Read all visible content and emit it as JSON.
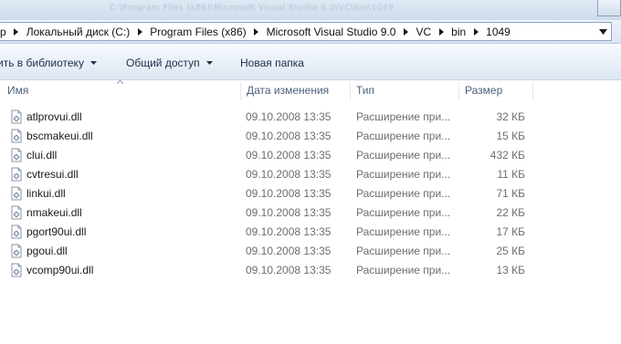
{
  "window": {
    "title": "C:\\Program Files (x86)\\Microsoft Visual Studio 9.0\\VC\\bin\\1049"
  },
  "address": {
    "breadcrumb": [
      {
        "label": "р"
      },
      {
        "label": "Локальный диск (C:)"
      },
      {
        "label": "Program Files (x86)"
      },
      {
        "label": "Microsoft Visual Studio 9.0"
      },
      {
        "label": "VC"
      },
      {
        "label": "bin"
      },
      {
        "label": "1049"
      }
    ]
  },
  "toolbar": {
    "library_label": "ить в библиотеку",
    "share_label": "Общий доступ",
    "new_folder_label": "Новая папка"
  },
  "columns": {
    "name": "Имя",
    "date": "Дата изменения",
    "type": "Тип",
    "size": "Размер"
  },
  "files": [
    {
      "name": "atlprovui.dll",
      "date": "09.10.2008 13:35",
      "type": "Расширение при...",
      "size": "32 КБ",
      "icon": "dll-file-icon"
    },
    {
      "name": "bscmakeui.dll",
      "date": "09.10.2008 13:35",
      "type": "Расширение при...",
      "size": "15 КБ",
      "icon": "dll-file-icon"
    },
    {
      "name": "clui.dll",
      "date": "09.10.2008 13:35",
      "type": "Расширение при...",
      "size": "432 КБ",
      "icon": "dll-file-icon"
    },
    {
      "name": "cvtresui.dll",
      "date": "09.10.2008 13:35",
      "type": "Расширение при...",
      "size": "11 КБ",
      "icon": "dll-file-icon"
    },
    {
      "name": "linkui.dll",
      "date": "09.10.2008 13:35",
      "type": "Расширение при...",
      "size": "71 КБ",
      "icon": "dll-file-icon"
    },
    {
      "name": "nmakeui.dll",
      "date": "09.10.2008 13:35",
      "type": "Расширение при...",
      "size": "22 КБ",
      "icon": "dll-file-icon"
    },
    {
      "name": "pgort90ui.dll",
      "date": "09.10.2008 13:35",
      "type": "Расширение при...",
      "size": "17 КБ",
      "icon": "dll-file-icon"
    },
    {
      "name": "pgoui.dll",
      "date": "09.10.2008 13:35",
      "type": "Расширение при...",
      "size": "25 КБ",
      "icon": "dll-file-icon"
    },
    {
      "name": "vcomp90ui.dll",
      "date": "09.10.2008 13:35",
      "type": "Расширение при...",
      "size": "13 КБ",
      "icon": "dll-file-icon"
    }
  ]
}
